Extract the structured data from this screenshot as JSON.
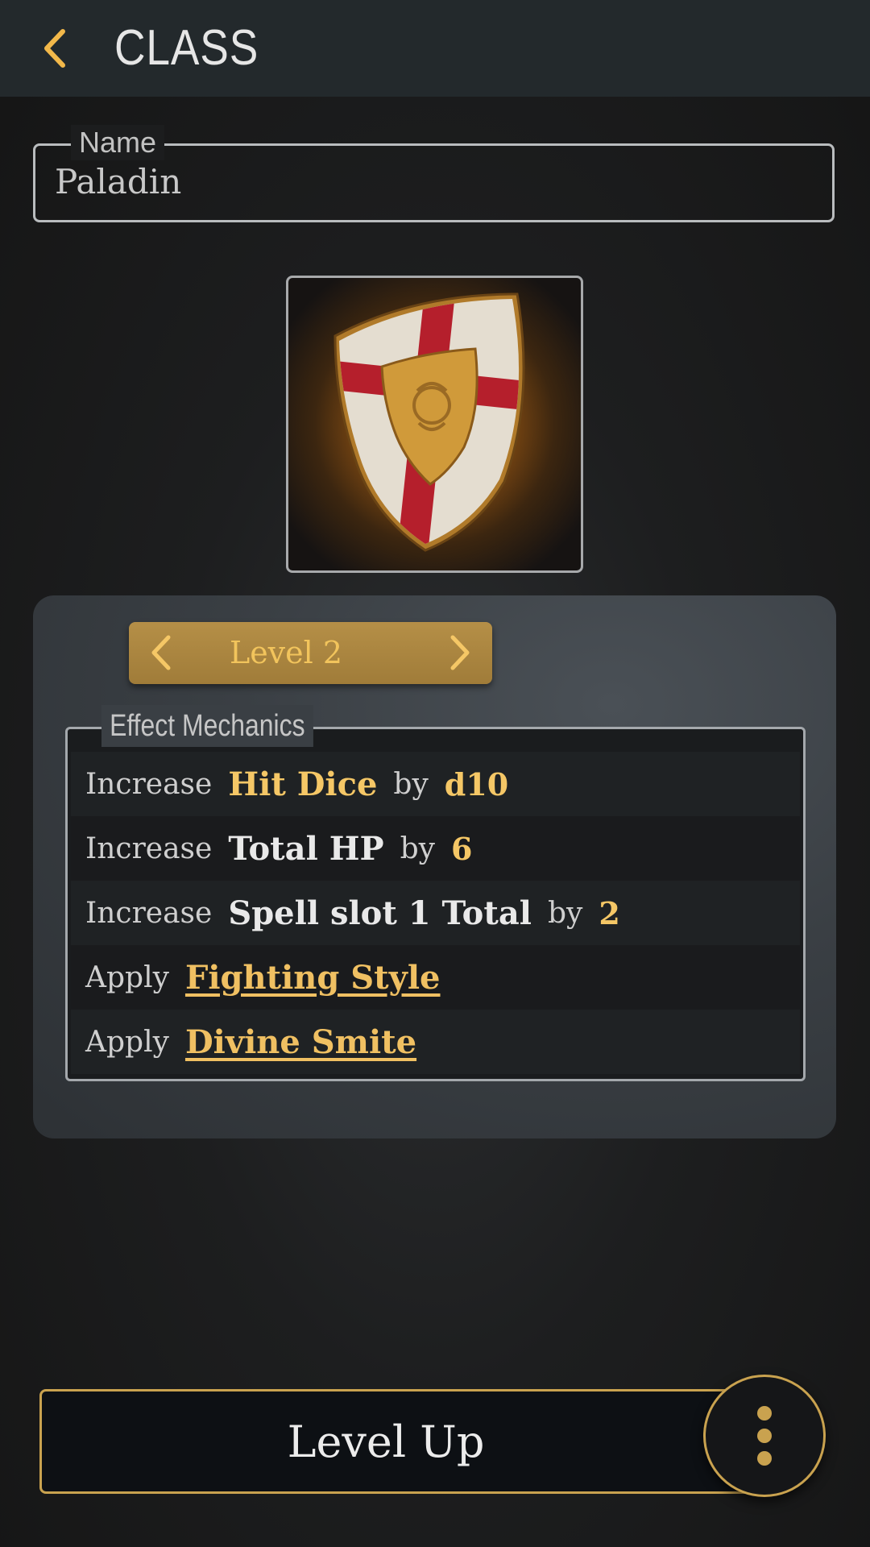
{
  "header": {
    "title": "CLASS",
    "back_icon": "chevron-left-icon"
  },
  "name_field": {
    "label": "Name",
    "value": "Paladin"
  },
  "class_image": {
    "icon": "paladin-shield-icon"
  },
  "level_selector": {
    "label": "Level 2",
    "prev_icon": "chevron-left-icon",
    "next_icon": "chevron-right-icon"
  },
  "mechanics": {
    "title": "Effect Mechanics",
    "rows": [
      {
        "verb": "Increase",
        "stat": "Hit Dice",
        "by": "by",
        "value": "d10"
      },
      {
        "verb": "Increase",
        "stat": "Total HP",
        "by": "by",
        "value": "6"
      },
      {
        "verb": "Increase",
        "stat": "Spell slot 1 Total",
        "by": "by",
        "value": "2"
      },
      {
        "verb": "Apply",
        "link": "Fighting Style"
      },
      {
        "verb": "Apply",
        "link": "Divine Smite"
      }
    ]
  },
  "footer": {
    "level_up_label": "Level Up",
    "more_icon": "more-vertical-icon"
  },
  "colors": {
    "accent": "#f5c766",
    "gold_border": "#c9a24f",
    "topbar": "#23292c"
  }
}
